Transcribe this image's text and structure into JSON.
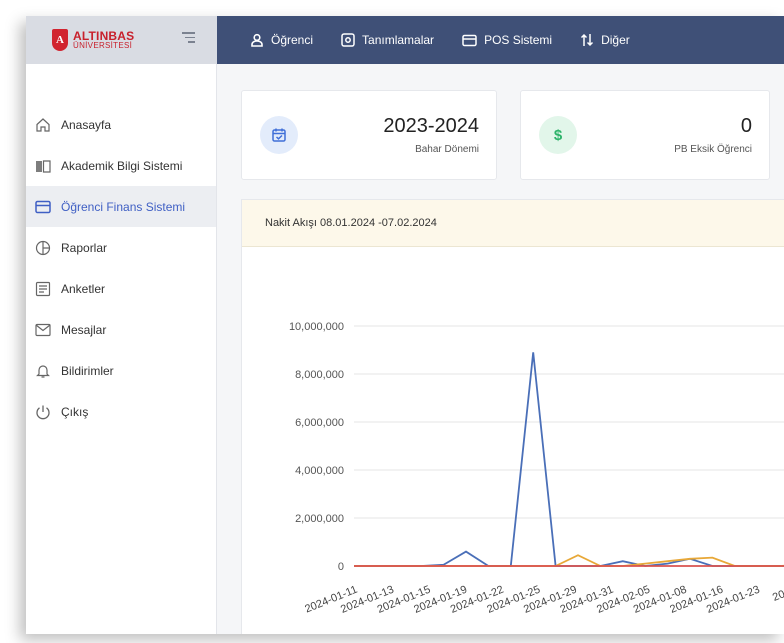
{
  "logo": {
    "name": "ALTINBAS",
    "sub": "ÜNİVERSİTESİ",
    "mark": "A"
  },
  "topnav": [
    {
      "label": "Öğrenci",
      "icon": "user-icon"
    },
    {
      "label": "Tanımlamalar",
      "icon": "settings-box-icon"
    },
    {
      "label": "POS Sistemi",
      "icon": "credit-card-icon"
    },
    {
      "label": "Diğer",
      "icon": "swap-icon"
    }
  ],
  "sidebar": {
    "items": [
      {
        "label": "Anasayfa",
        "icon": "home-icon"
      },
      {
        "label": "Akademik Bilgi Sistemi",
        "icon": "book-icon"
      },
      {
        "label": "Öğrenci Finans Sistemi",
        "icon": "credit-card-icon",
        "active": true
      },
      {
        "label": "Raporlar",
        "icon": "pie-chart-icon"
      },
      {
        "label": "Anketler",
        "icon": "list-icon"
      },
      {
        "label": "Mesajlar",
        "icon": "mail-icon"
      },
      {
        "label": "Bildirimler",
        "icon": "bell-icon"
      },
      {
        "label": "Çıkış",
        "icon": "power-icon"
      }
    ]
  },
  "cards": [
    {
      "value": "2023-2024",
      "label": "Bahar Dönemi",
      "icon": "calendar-check-icon"
    },
    {
      "value": "0",
      "label": "PB Eksik Öğrenci",
      "icon": "dollar-icon",
      "icon_text": "$"
    }
  ],
  "chart_panel": {
    "title": "Nakit Akışı 08.01.2024 -07.02.2024"
  },
  "colors": {
    "accent": "#3f5fc4",
    "topbar": "#3f5077",
    "brand": "#c8202c"
  },
  "chart_data": {
    "type": "line",
    "categories": [
      "2024-01-11",
      "2024-01-13",
      "2024-01-15",
      "2024-01-19",
      "2024-01-22",
      "2024-01-25",
      "2024-01-29",
      "2024-01-31",
      "2024-02-05",
      "2024-01-08",
      "2024-01-16",
      "2024-01-23",
      "2024"
    ],
    "x_positions": [
      0,
      1.5,
      3,
      4.5,
      6,
      7,
      8,
      9.5,
      11,
      12.5,
      13.5,
      14.5,
      15.5,
      16.5,
      17.5,
      18.5,
      20
    ],
    "series": [
      {
        "color": "#4a6fb8",
        "values": [
          0,
          0,
          0,
          0,
          50000,
          600000,
          0,
          0,
          8900000,
          0,
          0,
          0,
          200000,
          0,
          100000,
          300000,
          0,
          0,
          0,
          0,
          0
        ]
      },
      {
        "color": "#e8a838",
        "values": [
          0,
          0,
          0,
          0,
          0,
          0,
          0,
          0,
          0,
          0,
          450000,
          0,
          0,
          100000,
          200000,
          300000,
          350000,
          0,
          0,
          0,
          50000
        ]
      },
      {
        "color": "#d9534f",
        "values": [
          0,
          0,
          0,
          0,
          0,
          0,
          0,
          0,
          0,
          0,
          0,
          0,
          0,
          0,
          0,
          0,
          0,
          0,
          0,
          0,
          0
        ]
      }
    ],
    "yticks": [
      "0",
      "2,000,000",
      "4,000,000",
      "6,000,000",
      "8,000,000",
      "10,000,000"
    ],
    "ylim": [
      0,
      10000000
    ],
    "grid": true
  }
}
